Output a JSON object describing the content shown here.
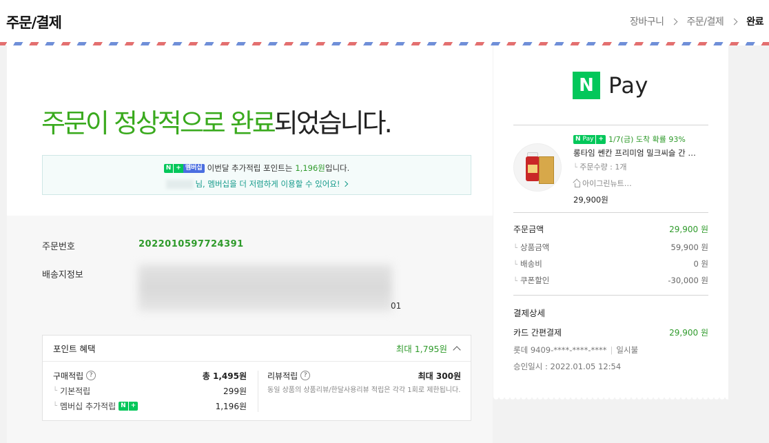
{
  "header": {
    "title": "주문/결제",
    "steps": [
      "장바구니",
      "주문/결제",
      "완료"
    ]
  },
  "complete": {
    "headline_green": "주문이 정상적으로 완료",
    "headline_rest": "되었습니다."
  },
  "membership": {
    "badge_n": "N",
    "badge_plus": "+",
    "badge_label": "멤버십",
    "text_before": "이번달 추가적립 포인트는",
    "points": "1,196원",
    "text_after": "입니다.",
    "link_text": "님, 멤버십을 더 저렴하게 이용할 수 있어요!"
  },
  "order": {
    "number_label": "주문번호",
    "number": "2022010597724391",
    "address_label": "배송지정보",
    "address_tail": "01"
  },
  "points": {
    "title": "포인트 혜택",
    "max": "최대 1,795원",
    "purchase_label": "구매적립",
    "purchase_total": "총 1,495원",
    "basic_label": "기본적립",
    "basic_value": "299원",
    "member_label": "멤버십 추가적립",
    "member_value": "1,196원",
    "review_label": "리뷰적립",
    "review_max": "최대 300원",
    "review_note": "동일 상품의 상품리뷰/한달사용리뷰 적립은 각각 1회로 제한됩니다."
  },
  "receipt": {
    "logo_n": "N",
    "logo_text": "Pay",
    "delivery_badge": "Pay",
    "delivery_text": "1/7(금) 도착 확률 93%",
    "product_name": "롱타임 쎈칸 프리미엄 밀크씨슬 간 …",
    "quantity": "주문수량 : 1개",
    "store": "아이그린뉴트…",
    "price": "29,900원",
    "order_amount_label": "주문금액",
    "order_amount": "29,900 원",
    "product_amount_label": "상품금액",
    "product_amount": "59,900 원",
    "shipping_label": "배송비",
    "shipping": "0 원",
    "coupon_label": "쿠폰할인",
    "coupon": "-30,000 원",
    "payment_title": "결제상세",
    "payment_method": "카드 간편결제",
    "payment_amount": "29,900 원",
    "card": "롯데 9409-****-****-****",
    "installment": "일시불",
    "approval": "승인일시 : 2022.01.05 12:54"
  },
  "colors": {
    "accent_green": "#3aaa1e",
    "naver_green": "#03c75a",
    "member_blue": "#4a6ee0"
  }
}
